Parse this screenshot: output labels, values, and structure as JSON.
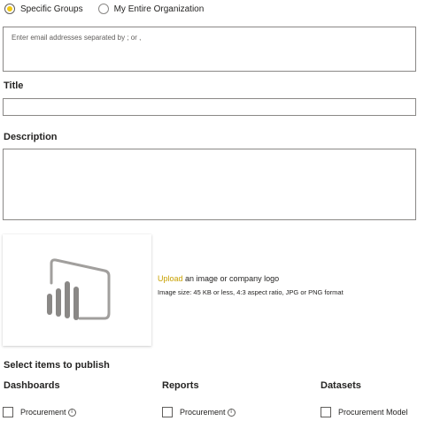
{
  "audience": {
    "options": [
      {
        "label": "Specific Groups",
        "selected": true
      },
      {
        "label": "My Entire Organization",
        "selected": false
      }
    ],
    "email_placeholder": "Enter email addresses separated by ; or ,"
  },
  "form": {
    "title_label": "Title",
    "title_value": "",
    "description_label": "Description",
    "description_value": ""
  },
  "logo": {
    "icon": "power-bi-logo-icon",
    "upload_link": "Upload",
    "upload_text": " an image or company logo",
    "hint": "Image size: 45 KB or less, 4:3 aspect ratio, JPG or PNG format"
  },
  "publish": {
    "title": "Select items to publish",
    "columns": [
      {
        "title": "Dashboards",
        "items": [
          {
            "label": "Procurement",
            "info": true,
            "checked": false
          }
        ]
      },
      {
        "title": "Reports",
        "items": [
          {
            "label": "Procurement",
            "info": true,
            "checked": false
          }
        ]
      },
      {
        "title": "Datasets",
        "items": [
          {
            "label": "Procurement Model",
            "info": false,
            "checked": false
          }
        ]
      }
    ]
  },
  "colors": {
    "accent": "#f2c811",
    "link": "#c8a100",
    "border": "#8a8886",
    "text": "#252423"
  }
}
